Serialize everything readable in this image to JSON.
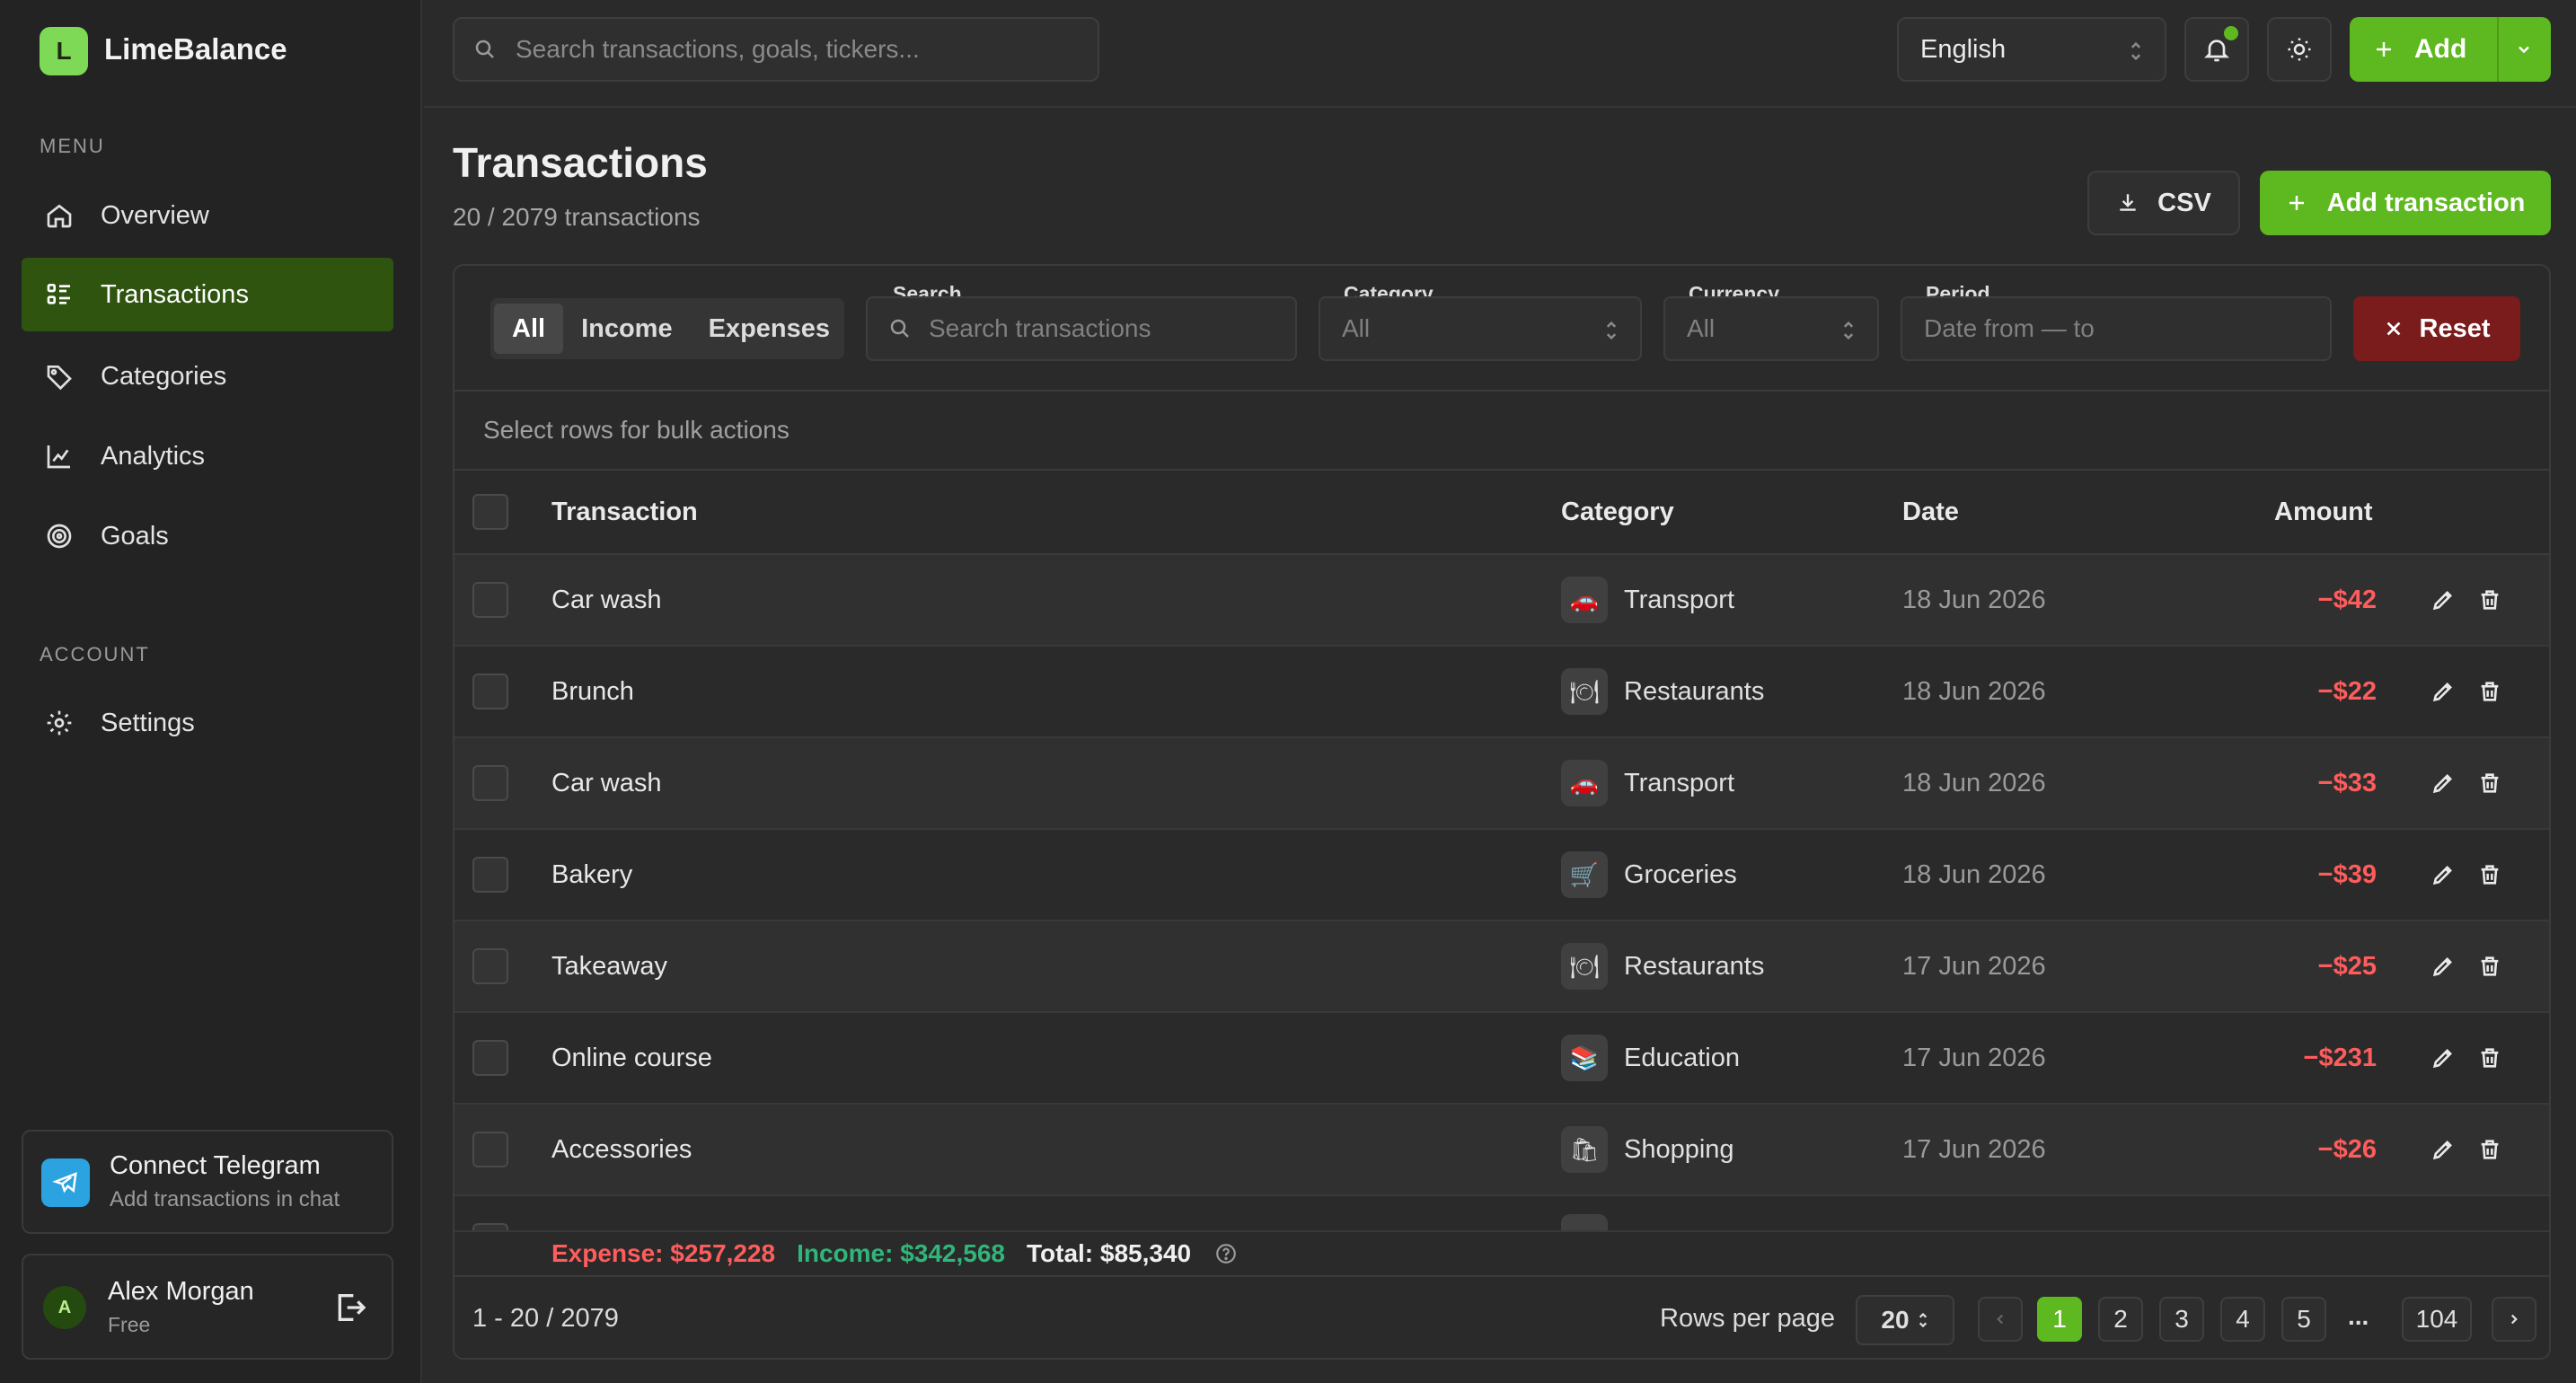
{
  "app": {
    "name": "LimeBalance",
    "logo_letter": "L"
  },
  "sidebar": {
    "menu_label": "MENU",
    "account_label": "ACCOUNT",
    "items": [
      {
        "label": "Overview",
        "icon": "home-icon"
      },
      {
        "label": "Transactions",
        "icon": "list-icon",
        "active": true
      },
      {
        "label": "Categories",
        "icon": "tag-icon"
      },
      {
        "label": "Analytics",
        "icon": "chart-icon"
      },
      {
        "label": "Goals",
        "icon": "target-icon"
      }
    ],
    "account_items": [
      {
        "label": "Settings",
        "icon": "gear-icon"
      }
    ],
    "telegram": {
      "title": "Connect Telegram",
      "subtitle": "Add transactions in chat"
    },
    "user": {
      "initial": "A",
      "name": "Alex Morgan",
      "plan": "Free"
    }
  },
  "topbar": {
    "search_placeholder": "Search transactions, goals, tickers...",
    "language": "English",
    "add_label": "Add"
  },
  "page": {
    "title": "Transactions",
    "subtitle": "20 / 2079 transactions",
    "csv_label": "CSV",
    "add_transaction_label": "Add transaction"
  },
  "filters": {
    "type_tabs": [
      "All",
      "Income",
      "Expenses"
    ],
    "search": {
      "label": "Search",
      "placeholder": "Search transactions"
    },
    "category": {
      "label": "Category",
      "value": "All"
    },
    "currency": {
      "label": "Currency",
      "value": "All"
    },
    "period": {
      "label": "Period",
      "placeholder": "Date from — to"
    },
    "reset_label": "Reset"
  },
  "bulk_text": "Select rows for bulk actions",
  "table": {
    "headers": {
      "transaction": "Transaction",
      "category": "Category",
      "date": "Date",
      "amount": "Amount"
    },
    "rows": [
      {
        "name": "Car wash",
        "category": "Transport",
        "emoji": "🚗",
        "date": "18 Jun 2026",
        "amount": "−$42"
      },
      {
        "name": "Brunch",
        "category": "Restaurants",
        "emoji": "🍽",
        "date": "18 Jun 2026",
        "amount": "−$22"
      },
      {
        "name": "Car wash",
        "category": "Transport",
        "emoji": "🚗",
        "date": "18 Jun 2026",
        "amount": "−$33"
      },
      {
        "name": "Bakery",
        "category": "Groceries",
        "emoji": "🛒",
        "date": "18 Jun 2026",
        "amount": "−$39"
      },
      {
        "name": "Takeaway",
        "category": "Restaurants",
        "emoji": "🍽",
        "date": "17 Jun 2026",
        "amount": "−$25"
      },
      {
        "name": "Online course",
        "category": "Education",
        "emoji": "📚",
        "date": "17 Jun 2026",
        "amount": "−$231"
      },
      {
        "name": "Accessories",
        "category": "Shopping",
        "emoji": "🛍",
        "date": "17 Jun 2026",
        "amount": "−$26"
      }
    ]
  },
  "summary": {
    "expense": "Expense: $257,228",
    "income": "Income: $342,568",
    "total": "Total: $85,340"
  },
  "pagination": {
    "range": "1 - 20 / 2079",
    "rows_per_page_label": "Rows per page",
    "rows_per_page": "20",
    "pages": [
      "1",
      "2",
      "3",
      "4",
      "5"
    ],
    "ellipsis": "...",
    "last_page": "104",
    "current": "1"
  },
  "colors": {
    "accent": "#5eb81f",
    "expense": "#ff5c5c",
    "income": "#2fb67a",
    "reset": "#7a1c1c"
  }
}
